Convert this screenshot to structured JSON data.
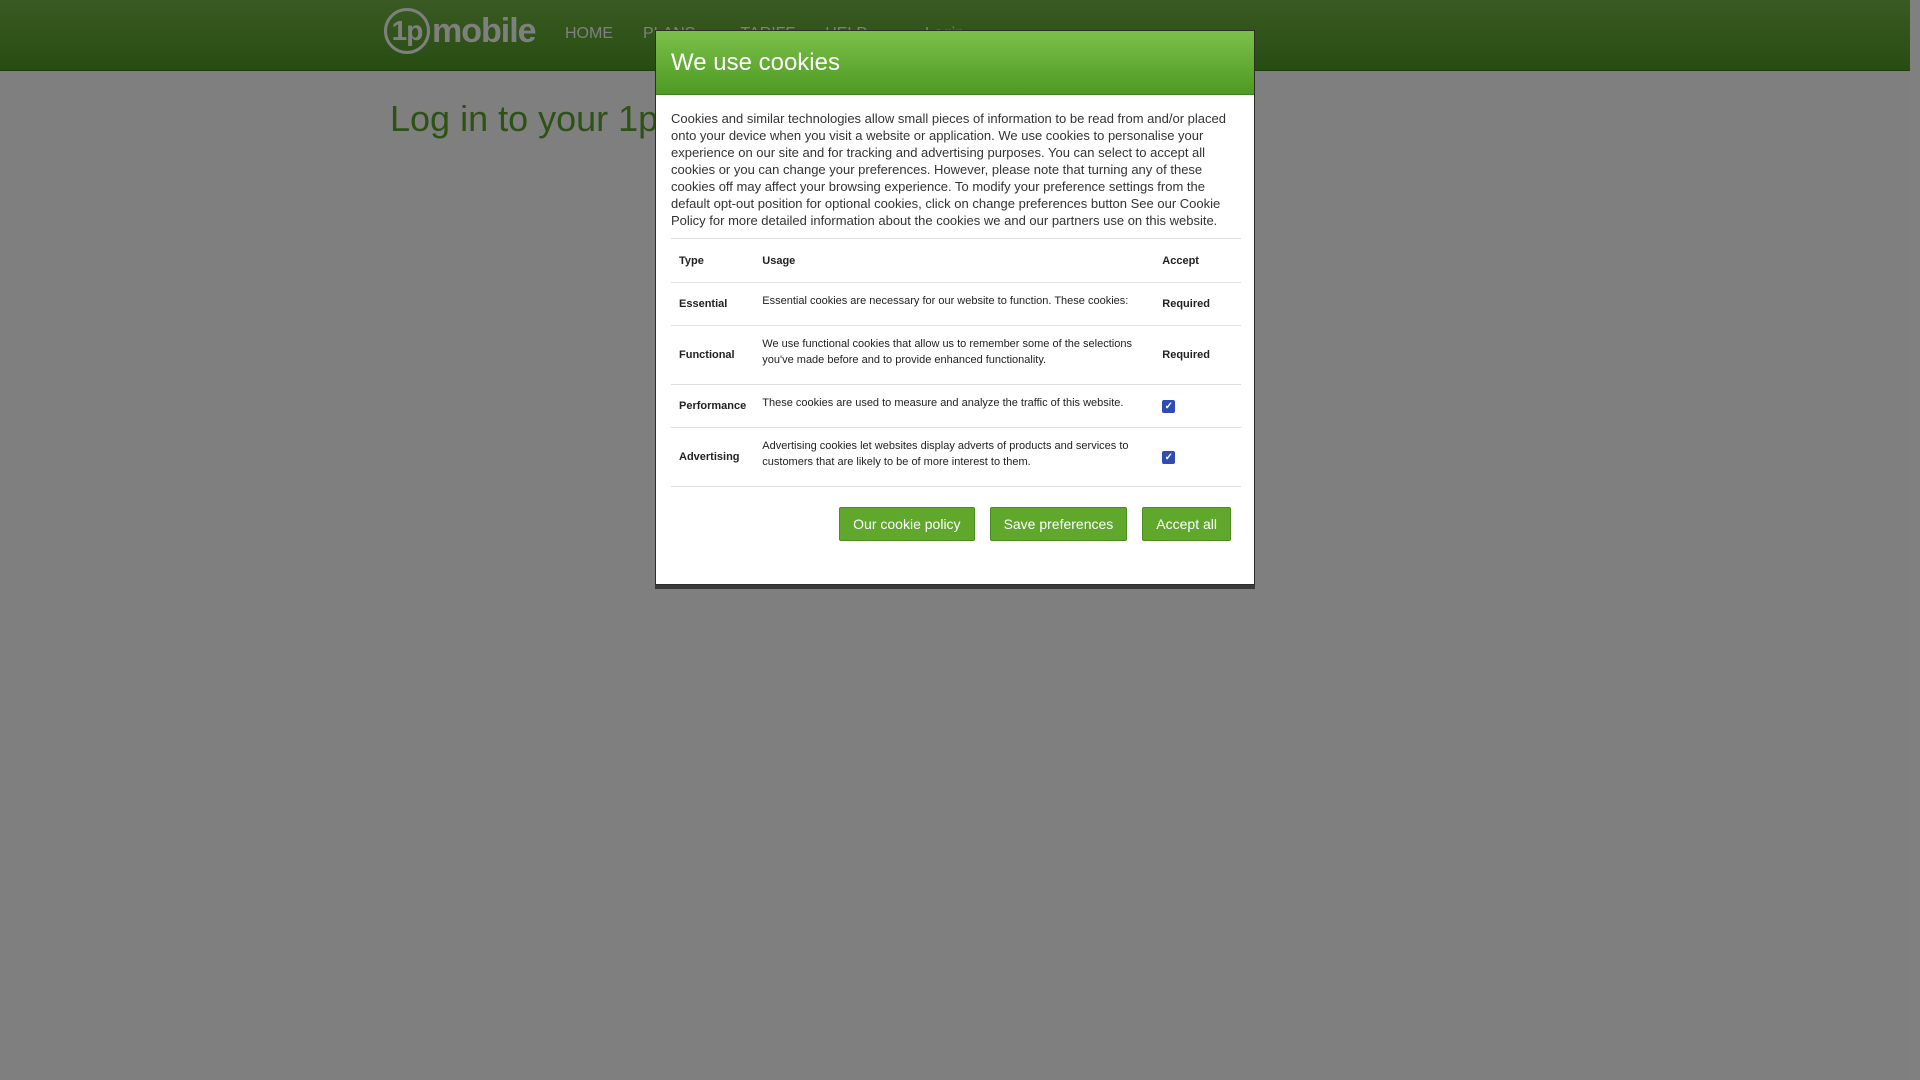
{
  "site": {
    "logo_mark": "1p",
    "logo_word": "mobile",
    "nav": [
      {
        "label": "HOME"
      },
      {
        "label": "PLANS"
      },
      {
        "label": "TARIFF"
      },
      {
        "label": "HELP"
      },
      {
        "label": "Login"
      }
    ],
    "page_title": "Log in to your 1p"
  },
  "modal": {
    "title": "We use cookies",
    "intro": "Cookies and similar technologies allow small pieces of information to be read from and/or placed onto your device when you visit a website or application. We use cookies to personalise your experience on our site and for tracking and advertising purposes. You can select to accept all cookies or you can change your preferences. However, please note that turning any of these cookies off may affect your browsing experience. To modify your preference settings from the default opt-out position for optional cookies, click on change preferences button See our Cookie Policy for more detailed information about the cookies we and our partners use on this website.",
    "table": {
      "headers": {
        "type": "Type",
        "usage": "Usage",
        "accept": "Accept"
      },
      "rows": [
        {
          "type": "Essential",
          "usage": "Essential cookies are necessary for our website to function. These cookies:",
          "accept": "Required"
        },
        {
          "type": "Functional",
          "usage": "We use functional cookies that allow us to remember some of the selections you've made before and to provide enhanced functionality.",
          "accept": "Required"
        },
        {
          "type": "Performance",
          "usage": "These cookies are used to measure and analyze the traffic of this website.",
          "accept_checked": true
        },
        {
          "type": "Advertising",
          "usage": "Advertising cookies let websites display adverts of products and services to customers that are likely to be of more interest to them.",
          "accept_checked": true
        }
      ]
    },
    "buttons": {
      "policy": "Our cookie policy",
      "save": "Save preferences",
      "accept_all": "Accept all"
    }
  },
  "colors": {
    "brand_green": "#5fa82c",
    "header_green": "#4f9a25",
    "checkbox_blue": "#2f4bb5"
  }
}
